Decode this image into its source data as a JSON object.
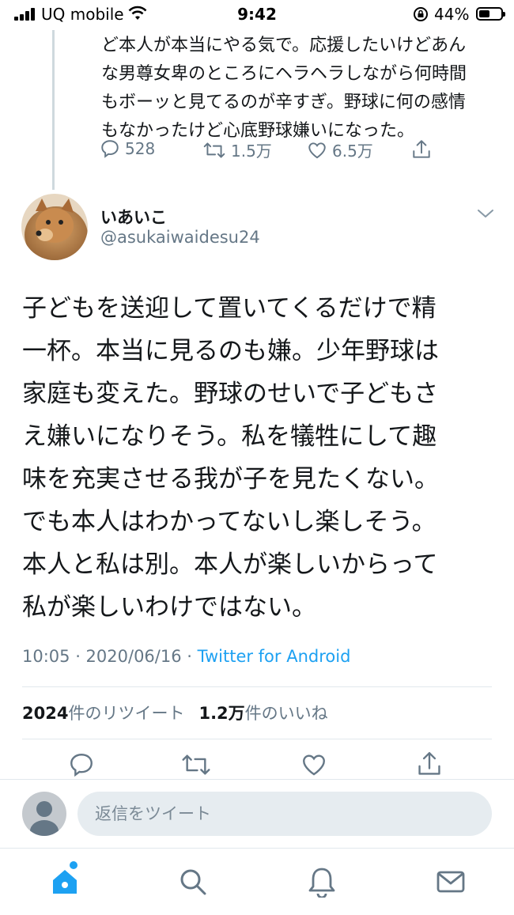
{
  "status_bar": {
    "carrier": "UQ mobile",
    "time": "9:42",
    "battery": "44%"
  },
  "previous_tweet": {
    "text_lines": [
      "ど本人が本当にやる気で。応援したいけどあん",
      "な男尊女卑のところにヘラヘラしながら何時間",
      "もボーッと見てるのが辛すぎ。野球に何の感情",
      "もなかったけど心底野球嫌いになった。"
    ],
    "replies": "528",
    "retweets": "1.5万",
    "likes": "6.5万"
  },
  "tweet": {
    "author_name": "いあいこ",
    "author_handle": "@asukaiwaidesu24",
    "text_lines": [
      "子どもを送迎して置いてくるだけで精",
      "一杯。本当に見るのも嫌。少年野球は",
      "家庭も変えた。野球のせいで子どもさ",
      "え嫌いになりそう。私を犠牲にして趣",
      "味を充実させる我が子を見たくない。",
      "でも本人はわかってないし楽しそう。",
      "本人と私は別。本人が楽しいからって",
      "私が楽しいわけではない。"
    ],
    "timestamp": "10:05 · 2020/06/16 · ",
    "source": "Twitter for Android",
    "retweet_count": "2024",
    "retweet_label": "件のリツイート",
    "like_count": "1.2万",
    "like_label": "件のいいね"
  },
  "reply": {
    "placeholder": "返信をツイート"
  },
  "tabbar": {
    "items": [
      "home-icon",
      "search-icon",
      "notifications-icon",
      "messages-icon"
    ]
  },
  "colors": {
    "accent": "#1da1f2",
    "secondary_text": "#657786",
    "divider": "#e1e8ed"
  }
}
